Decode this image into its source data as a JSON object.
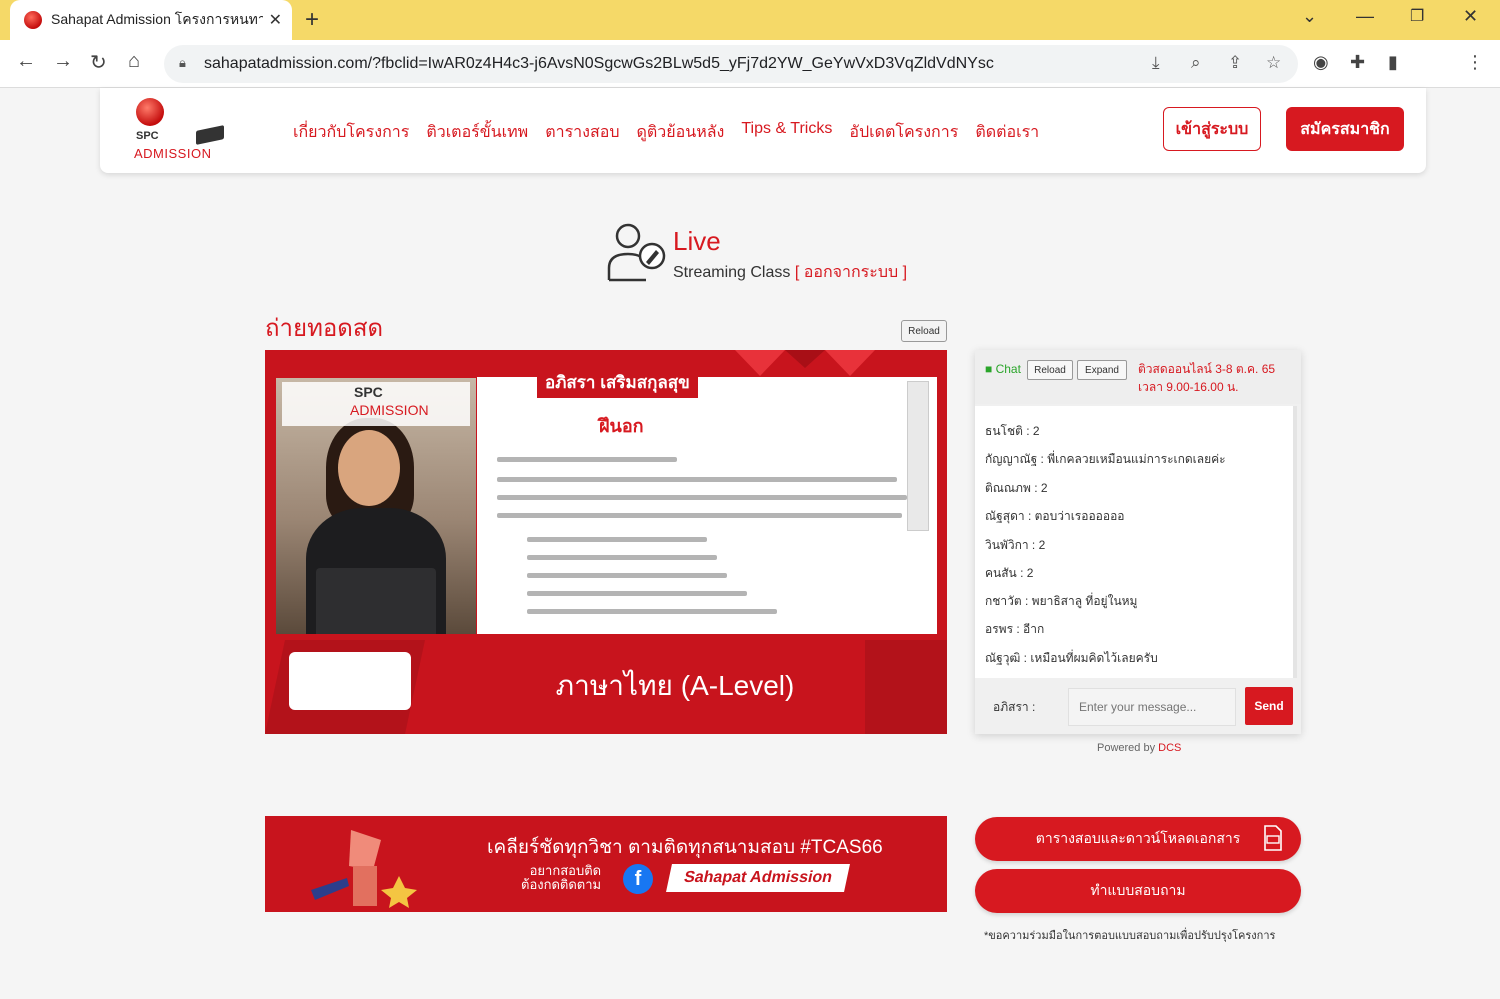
{
  "browser": {
    "tab_title": "Sahapat Admission โครงการหนทาง",
    "url": "sahapatadmission.com/?fbclid=IwAR0z4H4c3-j6AvsN0SgcwGs2BLw5d5_yFj7d2YW_GeYwVxD3VqZldVdNYsc"
  },
  "logo": {
    "line1": "SPC",
    "line2": "ADMISSION"
  },
  "nav": {
    "items": [
      "เกี่ยวกับโครงการ",
      "ติวเตอร์ขั้นเทพ",
      "ตารางสอบ",
      "ดูติวย้อนหลัง",
      "Tips & Tricks",
      "อัปเดตโครงการ",
      "ติดต่อเรา"
    ],
    "login_label": "เข้าสู่ระบบ",
    "register_label": "สมัครสมาชิก"
  },
  "live": {
    "title": "Live",
    "subtitle": "Streaming Class",
    "logout_label": "[ ออกจากระบบ ]"
  },
  "section_title": "ถ่ายทอดสด",
  "reload_label": "Reload",
  "video": {
    "slide_title": "อภิสรา เสริมสกุลสุข",
    "slide_word": "ฝึนอก",
    "subject": "ภาษาไทย (A-Level)"
  },
  "chat": {
    "chat_label": "Chat",
    "reload_label": "Reload",
    "expand_label": "Expand",
    "announce_line1": "ติวสดออนไลน์ 3-8 ต.ค. 65",
    "announce_line2": "เวลา 9.00-16.00 น.",
    "messages": [
      "ธนโชติ : 2",
      "กัญญาณัฐ : พี่เกคลวยเหมือนแม่การะเกดเลยค่ะ",
      "ติณณภพ : 2",
      "ณัฐสุดา : ตอบว่าเรออออออ",
      "วินพัวิกา : 2",
      "คนสัน : 2",
      "กชาวัต : พยาธิสาลู ที่อยู่ในหมู",
      "อรพร : อีาก",
      "ณัฐวุฒิ : เหมือนที่ผมคิดไว้เลยครับ"
    ],
    "user_name": "อภิสรา :",
    "input_placeholder": "Enter your message...",
    "send_label": "Send",
    "powered_prefix": "Powered by",
    "powered_brand": "DCS"
  },
  "promo": {
    "headline": "เคลียร์ชัดทุกวิชา ตามติดทุกสนามสอบ #TCAS66",
    "small_line1": "อยากสอบติด",
    "small_line2": "ต้องกดติดตาม",
    "fb_letter": "f",
    "page_name": "Sahapat Admission"
  },
  "buttons": {
    "schedule_label": "ตารางสอบและดาวน์โหลดเอกสาร",
    "survey_label": "ทำแบบสอบถาม",
    "note": "*ขอความร่วมมือในการตอบแบบสอบถามเพื่อปรับปรุงโครงการ"
  },
  "colors": {
    "brand_red": "#d71920",
    "tab_bar": "#f5d968",
    "chat_green": "#2aa52a"
  }
}
